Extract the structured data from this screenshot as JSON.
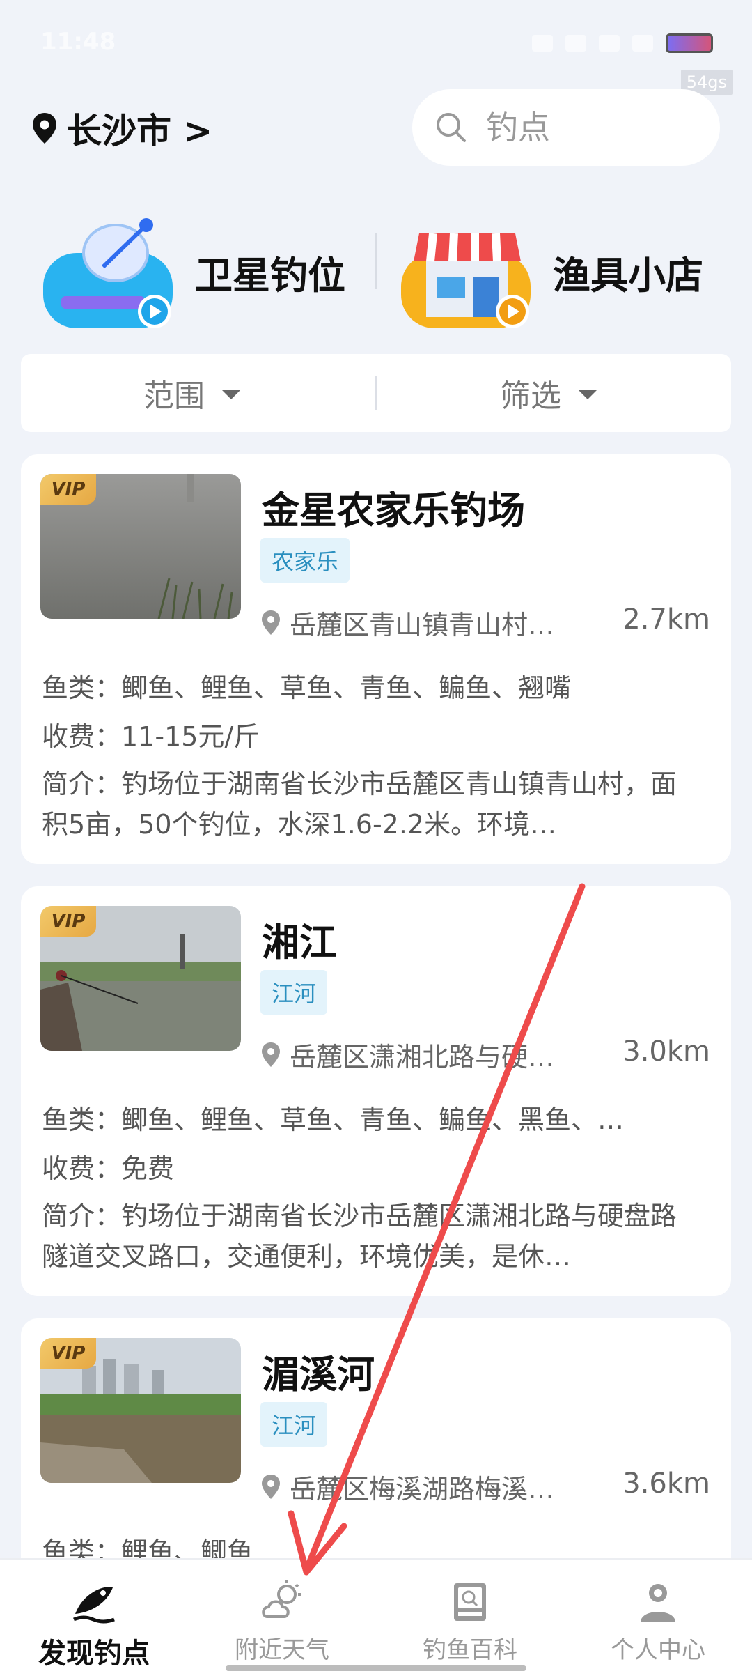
{
  "status_bar": {
    "time": "11:48",
    "fps": "54gs"
  },
  "header": {
    "city": "长沙市 >",
    "search_placeholder": "钓点"
  },
  "features": [
    {
      "label": "卫星钓位",
      "icon": "satellite-dish-icon"
    },
    {
      "label": "渔具小店",
      "icon": "shop-icon"
    }
  ],
  "filters": {
    "range": "范围",
    "select": "筛选"
  },
  "spots": [
    {
      "vip": "VIP",
      "name": "金星农家乐钓场",
      "tag": "农家乐",
      "address": "岳麓区青山镇青山村…",
      "distance": "2.7km",
      "fish": "鱼类：鲫鱼、鲤鱼、草鱼、青鱼、鳊鱼、翘嘴",
      "fee": "收费：11-15元/斤",
      "intro": "简介：钓场位于湖南省长沙市岳麓区青山镇青山村，面积5亩，50个钓位，水深1.6-2.2米。环境…"
    },
    {
      "vip": "VIP",
      "name": "湘江",
      "tag": "江河",
      "address": "岳麓区潇湘北路与硬…",
      "distance": "3.0km",
      "fish": "鱼类：鲫鱼、鲤鱼、草鱼、青鱼、鳊鱼、黑鱼、…",
      "fee": "收费：免费",
      "intro": "简介：钓场位于湖南省长沙市岳麓区潇湘北路与硬盘路隧道交叉路口，交通便利，环境优美，是休…"
    },
    {
      "vip": "VIP",
      "name": "湄溪河",
      "tag": "江河",
      "address": "岳麓区梅溪湖路梅溪…",
      "distance": "3.6km",
      "fish": "鱼类：鲤鱼、鲫鱼"
    }
  ],
  "bottom_nav": [
    {
      "label": "发现钓点",
      "icon": "fish-icon",
      "active": true
    },
    {
      "label": "附近天气",
      "icon": "weather-icon"
    },
    {
      "label": "钓鱼百科",
      "icon": "encyclopedia-icon"
    },
    {
      "label": "个人中心",
      "icon": "profile-icon"
    }
  ],
  "colors": {
    "background": "#f0f3f9",
    "tag_bg": "#e3f3fb",
    "tag_text": "#2a8fbf",
    "annotation_arrow": "#ee4b4b"
  }
}
